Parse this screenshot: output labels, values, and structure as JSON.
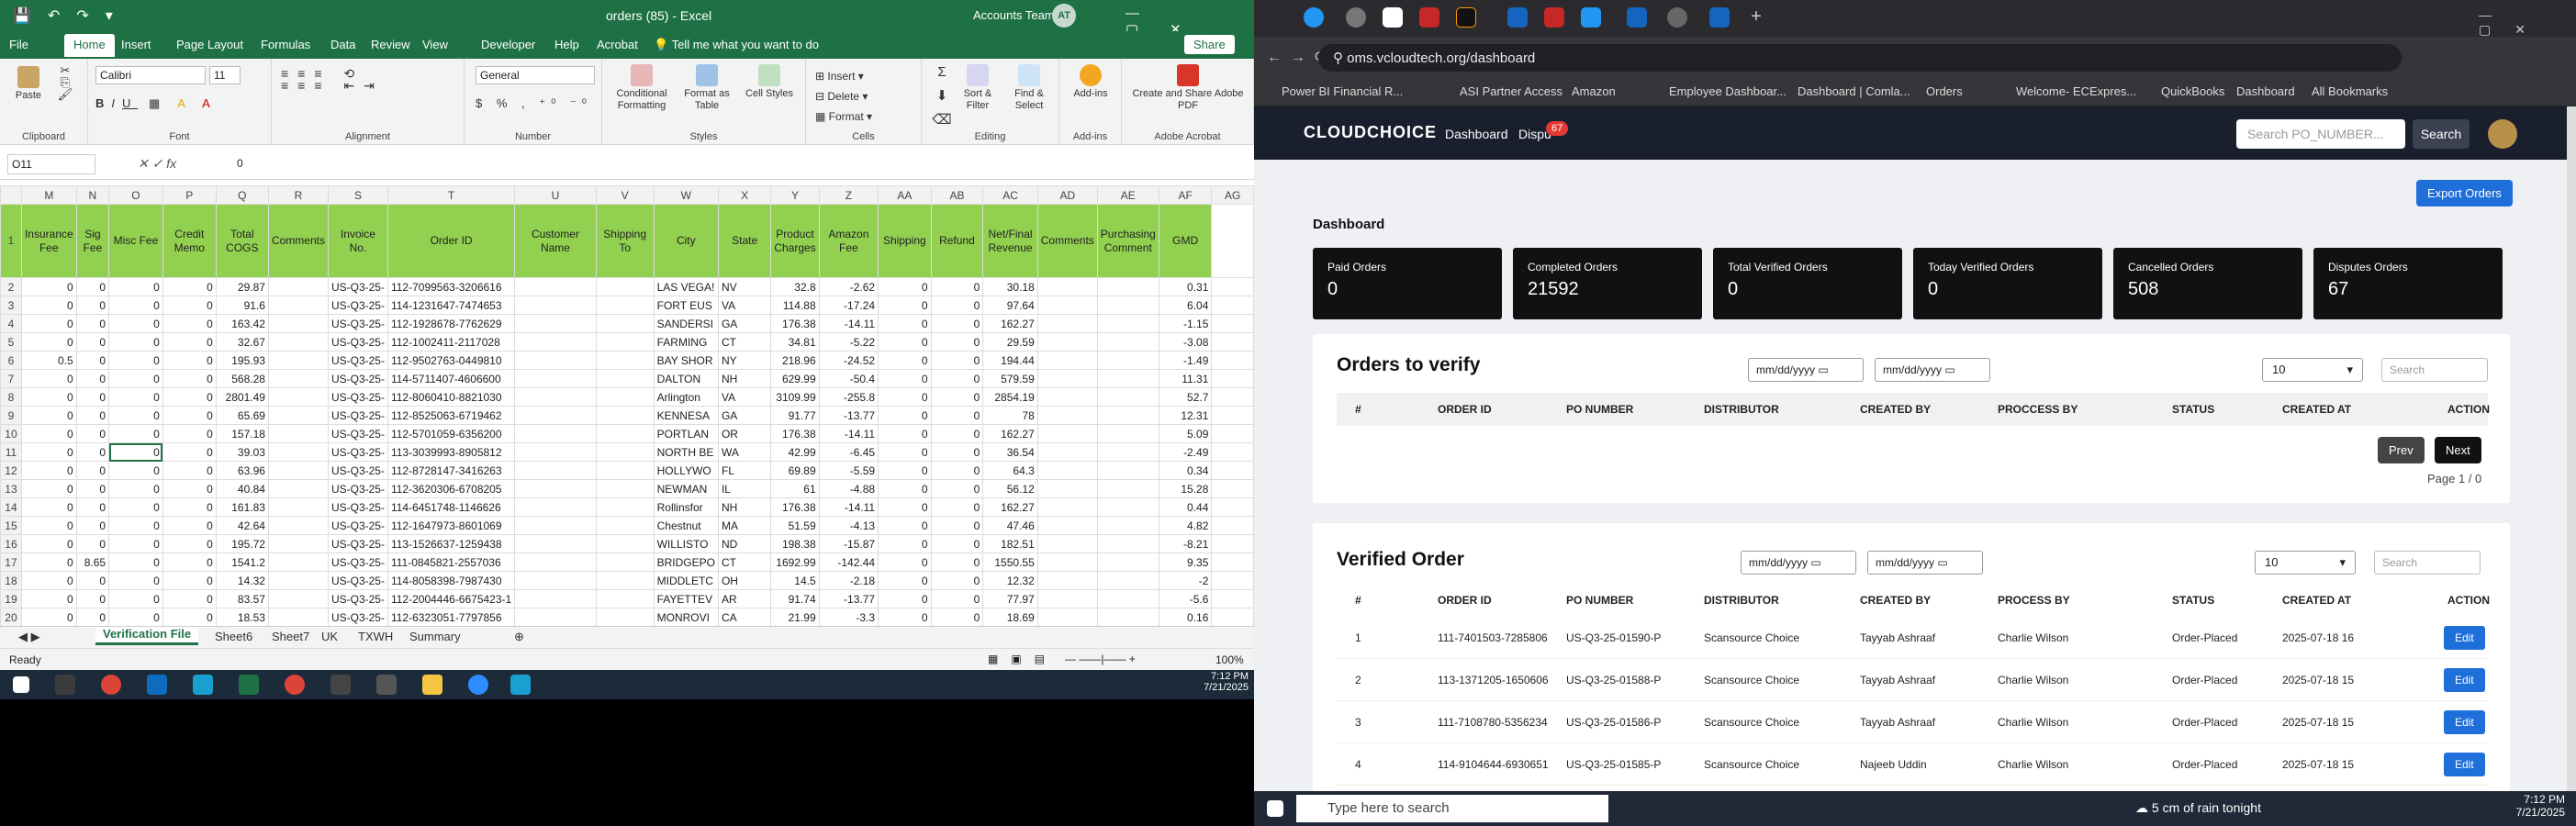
{
  "excel": {
    "filename": "orders (85) - Excel",
    "account": "Accounts Team",
    "avatar_initials": "AT",
    "tabs": [
      "File",
      "Home",
      "Insert",
      "Page Layout",
      "Formulas",
      "Data",
      "Review",
      "View",
      "Developer",
      "Help",
      "Acrobat"
    ],
    "tell_me": "Tell me what you want to do",
    "share": "Share",
    "ribbon": {
      "font_name": "Calibri",
      "font_size": "11",
      "number_format": "General",
      "groups": [
        "Clipboard",
        "Font",
        "Alignment",
        "Number",
        "Styles",
        "Cells",
        "Editing",
        "Add-ins",
        "Adobe Acrobat"
      ],
      "buttons": {
        "paste": "Paste",
        "conditional": "Conditional Formatting",
        "format_table": "Format as Table",
        "cell_styles": "Cell Styles",
        "insert": "Insert",
        "delete": "Delete",
        "format": "Format",
        "sort": "Sort & Filter",
        "find": "Find & Select",
        "addins": "Add-ins",
        "pdf": "Create and Share Adobe PDF"
      }
    },
    "name_box": "O11",
    "formula_value": "0",
    "columns": [
      "M",
      "N",
      "O",
      "P",
      "Q",
      "R",
      "S",
      "T",
      "U",
      "V",
      "W",
      "X",
      "Y",
      "Z",
      "AA",
      "AB",
      "AC",
      "AD",
      "AE",
      "AF",
      "AG"
    ],
    "headers": [
      "Insurance Fee",
      "Sig Fee",
      "Misc Fee",
      "Credit Memo",
      "Total COGS",
      "Comments",
      "Invoice No.",
      "Order ID",
      "Customer Name",
      "Shipping To",
      "City",
      "State",
      "Product Charges",
      "Amazon Fee",
      "Shipping",
      "Refund",
      "Net/Final Revenue",
      "Comments",
      "Purchasing Comment",
      "GMD",
      ""
    ],
    "rows": [
      [
        "2",
        "0",
        "0",
        "0",
        "0",
        "29.87",
        "",
        "US-Q3-25-",
        "112-7099563-3206616",
        "",
        "",
        "LAS VEGA!",
        "NV",
        "32.8",
        "-2.62",
        "0",
        "0",
        "30.18",
        "",
        "",
        "0.31"
      ],
      [
        "3",
        "0",
        "0",
        "0",
        "0",
        "91.6",
        "",
        "US-Q3-25-",
        "114-1231647-7474653",
        "",
        "",
        "FORT EUS",
        "VA",
        "114.88",
        "-17.24",
        "0",
        "0",
        "97.64",
        "",
        "",
        "6.04"
      ],
      [
        "4",
        "0",
        "0",
        "0",
        "0",
        "163.42",
        "",
        "US-Q3-25-",
        "112-1928678-7762629",
        "",
        "",
        "SANDERSI",
        "GA",
        "176.38",
        "-14.11",
        "0",
        "0",
        "162.27",
        "",
        "",
        "-1.15"
      ],
      [
        "5",
        "0",
        "0",
        "0",
        "0",
        "32.67",
        "",
        "US-Q3-25-",
        "112-1002411-2117028",
        "",
        "",
        "FARMING",
        "CT",
        "34.81",
        "-5.22",
        "0",
        "0",
        "29.59",
        "",
        "",
        "-3.08"
      ],
      [
        "6",
        "0.5",
        "0",
        "0",
        "0",
        "195.93",
        "",
        "US-Q3-25-",
        "112-9502763-0449810",
        "",
        "",
        "BAY SHOR",
        "NY",
        "218.96",
        "-24.52",
        "0",
        "0",
        "194.44",
        "",
        "",
        "-1.49"
      ],
      [
        "7",
        "0",
        "0",
        "0",
        "0",
        "568.28",
        "",
        "US-Q3-25-",
        "114-5711407-4606600",
        "",
        "",
        "DALTON",
        "NH",
        "629.99",
        "-50.4",
        "0",
        "0",
        "579.59",
        "",
        "",
        "11.31"
      ],
      [
        "8",
        "0",
        "0",
        "0",
        "0",
        "2801.49",
        "",
        "US-Q3-25-",
        "112-8060410-8821030",
        "",
        "",
        "Arlington",
        "VA",
        "3109.99",
        "-255.8",
        "0",
        "0",
        "2854.19",
        "",
        "",
        "52.7"
      ],
      [
        "9",
        "0",
        "0",
        "0",
        "0",
        "65.69",
        "",
        "US-Q3-25-",
        "112-8525063-6719462",
        "",
        "",
        "KENNESA",
        "GA",
        "91.77",
        "-13.77",
        "0",
        "0",
        "78",
        "",
        "",
        "12.31"
      ],
      [
        "10",
        "0",
        "0",
        "0",
        "0",
        "157.18",
        "",
        "US-Q3-25-",
        "112-5701059-6356200",
        "",
        "",
        "PORTLAN",
        "OR",
        "176.38",
        "-14.11",
        "0",
        "0",
        "162.27",
        "",
        "",
        "5.09"
      ],
      [
        "11",
        "0",
        "0",
        "0",
        "0",
        "39.03",
        "",
        "US-Q3-25-",
        "113-3039993-8905812",
        "",
        "",
        "NORTH BE",
        "WA",
        "42.99",
        "-6.45",
        "0",
        "0",
        "36.54",
        "",
        "",
        "-2.49"
      ],
      [
        "12",
        "0",
        "0",
        "0",
        "0",
        "63.96",
        "",
        "US-Q3-25-",
        "112-8728147-3416263",
        "",
        "",
        "HOLLYWO",
        "FL",
        "69.89",
        "-5.59",
        "0",
        "0",
        "64.3",
        "",
        "",
        "0.34"
      ],
      [
        "13",
        "0",
        "0",
        "0",
        "0",
        "40.84",
        "",
        "US-Q3-25-",
        "112-3620306-6708205",
        "",
        "",
        "NEWMAN",
        "IL",
        "61",
        "-4.88",
        "0",
        "0",
        "56.12",
        "",
        "",
        "15.28"
      ],
      [
        "14",
        "0",
        "0",
        "0",
        "0",
        "161.83",
        "",
        "US-Q3-25-",
        "114-6451748-1146626",
        "",
        "",
        "Rollinsfor",
        "NH",
        "176.38",
        "-14.11",
        "0",
        "0",
        "162.27",
        "",
        "",
        "0.44"
      ],
      [
        "15",
        "0",
        "0",
        "0",
        "0",
        "42.64",
        "",
        "US-Q3-25-",
        "112-1647973-8601069",
        "",
        "",
        "Chestnut",
        "MA",
        "51.59",
        "-4.13",
        "0",
        "0",
        "47.46",
        "",
        "",
        "4.82"
      ],
      [
        "16",
        "0",
        "0",
        "0",
        "0",
        "195.72",
        "",
        "US-Q3-25-",
        "113-1526637-1259438",
        "",
        "",
        "WILLISTO",
        "ND",
        "198.38",
        "-15.87",
        "0",
        "0",
        "182.51",
        "",
        "",
        "-8.21"
      ],
      [
        "17",
        "0",
        "8.65",
        "0",
        "0",
        "1541.2",
        "",
        "US-Q3-25-",
        "111-0845821-2557036",
        "",
        "",
        "BRIDGEPO",
        "CT",
        "1692.99",
        "-142.44",
        "0",
        "0",
        "1550.55",
        "",
        "",
        "9.35"
      ],
      [
        "18",
        "0",
        "0",
        "0",
        "0",
        "14.32",
        "",
        "US-Q3-25-",
        "114-8058398-7987430",
        "",
        "",
        "MIDDLETC",
        "OH",
        "14.5",
        "-2.18",
        "0",
        "0",
        "12.32",
        "",
        "",
        "-2"
      ],
      [
        "19",
        "0",
        "0",
        "0",
        "0",
        "83.57",
        "",
        "US-Q3-25-",
        "112-2004446-6675423-1",
        "",
        "",
        "FAYETTEV",
        "AR",
        "91.74",
        "-13.77",
        "0",
        "0",
        "77.97",
        "",
        "",
        "-5.6"
      ],
      [
        "20",
        "0",
        "0",
        "0",
        "0",
        "18.53",
        "",
        "US-Q3-25-",
        "112-6323051-7797856",
        "",
        "",
        "MONROVI",
        "CA",
        "21.99",
        "-3.3",
        "0",
        "0",
        "18.69",
        "",
        "",
        "0.16"
      ]
    ],
    "sheet_tabs": [
      "Verification File",
      "Sheet6",
      "Sheet7",
      "UK",
      "TXWH",
      "Summary"
    ],
    "status_ready": "Ready",
    "zoom": "100%",
    "clock_time": "7:12 PM",
    "clock_date": "7/21/2025"
  },
  "browser": {
    "url": "oms.vcloudtech.org/dashboard",
    "bookmarks": [
      "Power BI Financial R...",
      "ASI Partner Access",
      "Amazon",
      "Employee Dashboar...",
      "Dashboard | Comla...",
      "Orders",
      "Welcome- ECExpres...",
      "QuickBooks",
      "Dashboard",
      "All Bookmarks"
    ],
    "logo": "CLOUDCHOICE",
    "nav": {
      "dashboard": "Dashboard",
      "disputes": "Dispu",
      "disputes_badge": "67"
    },
    "search_placeholder": "Search PO_NUMBER...",
    "search_button": "Search",
    "export_button": "Export Orders",
    "page_title": "Dashboard",
    "stats": [
      {
        "label": "Paid Orders",
        "value": "0"
      },
      {
        "label": "Completed Orders",
        "value": "21592"
      },
      {
        "label": "Total Verified Orders",
        "value": "0"
      },
      {
        "label": "Today Verified Orders",
        "value": "0"
      },
      {
        "label": "Cancelled Orders",
        "value": "508"
      },
      {
        "label": "Disputes Orders",
        "value": "67"
      }
    ],
    "verify": {
      "title": "Orders to verify",
      "date_placeholder": "mm/dd/yyyy",
      "page_size": "10",
      "search_placeholder": "Search",
      "columns": [
        "#",
        "ORDER ID",
        "PO NUMBER",
        "DISTRIBUTOR",
        "CREATED BY",
        "PROCCESS BY",
        "STATUS",
        "CREATED AT",
        "ACTION"
      ],
      "prev": "Prev",
      "next": "Next",
      "page_info": "Page 1 / 0"
    },
    "verified": {
      "title": "Verified Order",
      "date_placeholder": "mm/dd/yyyy",
      "page_size": "10",
      "search_placeholder": "Search",
      "columns": [
        "#",
        "ORDER ID",
        "PO NUMBER",
        "DISTRIBUTOR",
        "CREATED BY",
        "PROCESS BY",
        "STATUS",
        "CREATED AT",
        "ACTION"
      ],
      "rows": [
        {
          "n": "1",
          "order_id": "111-7401503-7285806",
          "po": "US-Q3-25-01590-P",
          "dist": "Scansource Choice",
          "created_by": "Tayyab Ashraaf",
          "process_by": "Charlie Wilson",
          "status": "Order-Placed",
          "created_at": "2025-07-18 16",
          "action": "Edit"
        },
        {
          "n": "2",
          "order_id": "113-1371205-1650606",
          "po": "US-Q3-25-01588-P",
          "dist": "Scansource Choice",
          "created_by": "Tayyab Ashraaf",
          "process_by": "Charlie Wilson",
          "status": "Order-Placed",
          "created_at": "2025-07-18 15",
          "action": "Edit"
        },
        {
          "n": "3",
          "order_id": "111-7108780-5356234",
          "po": "US-Q3-25-01586-P",
          "dist": "Scansource Choice",
          "created_by": "Tayyab Ashraaf",
          "process_by": "Charlie Wilson",
          "status": "Order-Placed",
          "created_at": "2025-07-18 15",
          "action": "Edit"
        },
        {
          "n": "4",
          "order_id": "114-9104644-6930651",
          "po": "US-Q3-25-01585-P",
          "dist": "Scansource Choice",
          "created_by": "Najeeb Uddin",
          "process_by": "Charlie Wilson",
          "status": "Order-Placed",
          "created_at": "2025-07-18 15",
          "action": "Edit"
        }
      ]
    },
    "taskbar": {
      "search": "Type here to search",
      "weather": "5 cm of rain tonight",
      "time": "7:12 PM",
      "date": "7/21/2025"
    }
  }
}
